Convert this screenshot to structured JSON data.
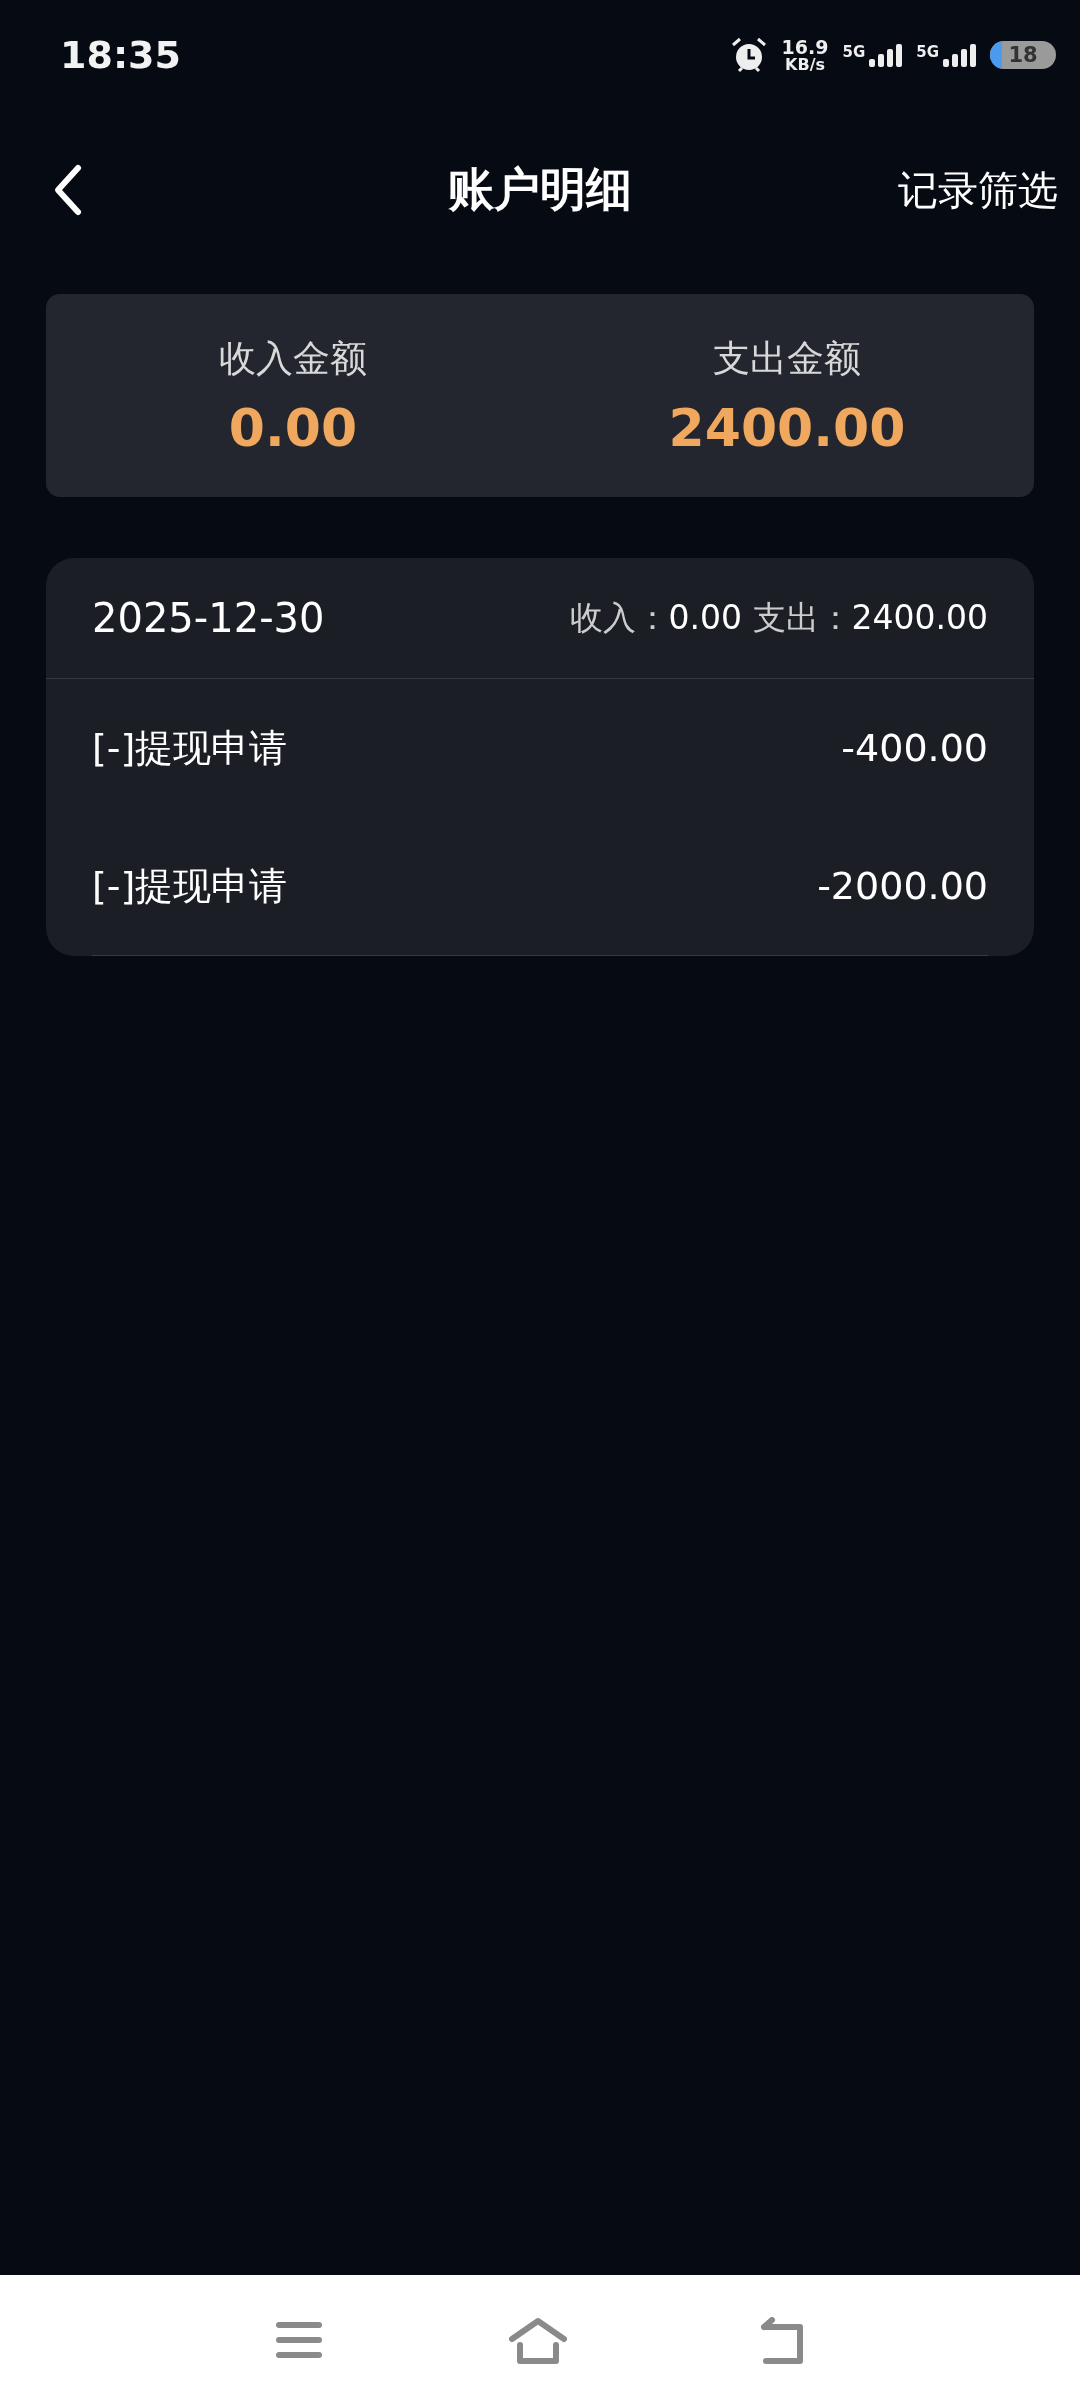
{
  "status_bar": {
    "time": "18:35",
    "speed_value": "16.9",
    "speed_unit": "KB/s",
    "networks": [
      "5G",
      "5G"
    ],
    "battery": "18"
  },
  "header": {
    "title": "账户明细",
    "action": "记录筛选"
  },
  "summary": [
    {
      "label": "收入金额",
      "value": "0.00"
    },
    {
      "label": "支出金额",
      "value": "2400.00"
    }
  ],
  "days": [
    {
      "date": "2025-12-30",
      "income_label": "收入：",
      "income": "0.00",
      "expense_label": "支出：",
      "expense": "2400.00",
      "entries": [
        {
          "title": "[-]提现申请",
          "amount": "-400.00"
        },
        {
          "title": "[-]提现申请",
          "amount": "-2000.00"
        }
      ]
    }
  ]
}
